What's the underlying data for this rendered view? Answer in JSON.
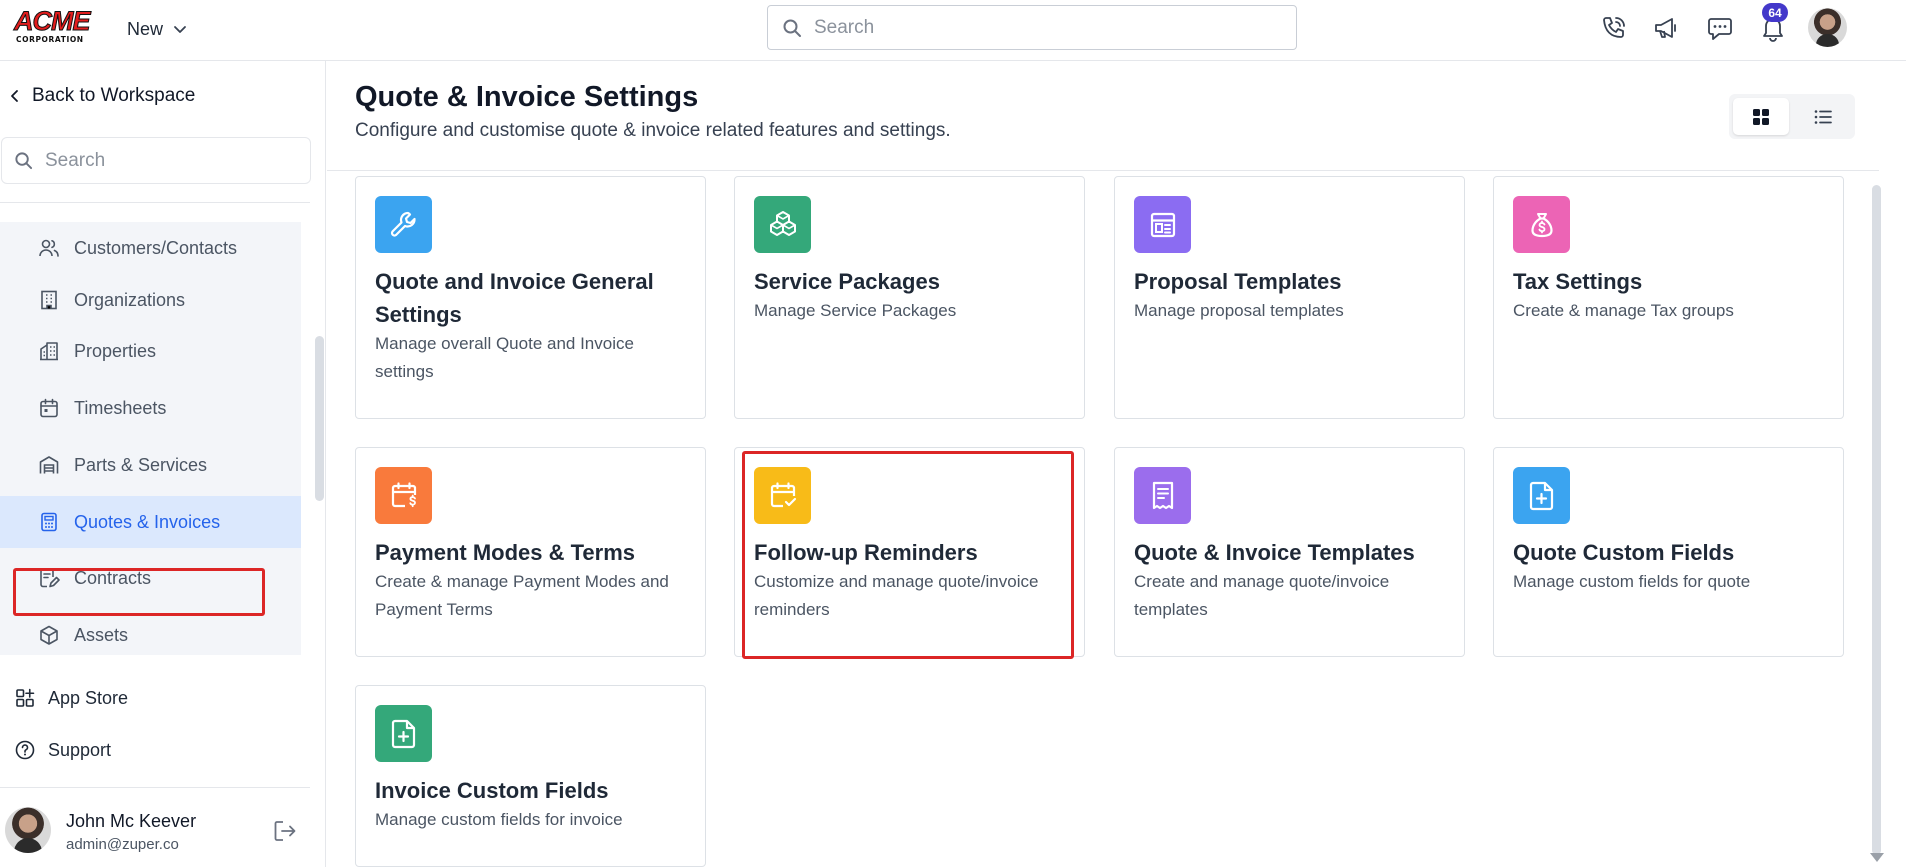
{
  "logo": {
    "main": "ACME",
    "sub": "CORPORATION"
  },
  "header": {
    "new_label": "New",
    "search_placeholder": "Search",
    "notification_count": "64"
  },
  "sidebar": {
    "back_label": "Back to Workspace",
    "search_placeholder": "Search",
    "items": [
      {
        "label": "Customers/Contacts",
        "icon": "users-icon"
      },
      {
        "label": "Organizations",
        "icon": "building-icon"
      },
      {
        "label": "Properties",
        "icon": "property-icon"
      },
      {
        "label": "Timesheets",
        "icon": "calendar-icon"
      },
      {
        "label": "Parts & Services",
        "icon": "warehouse-icon"
      },
      {
        "label": "Quotes & Invoices",
        "icon": "calculator-icon",
        "active": true
      },
      {
        "label": "Contracts",
        "icon": "contract-icon"
      },
      {
        "label": "Assets",
        "icon": "cube-icon"
      }
    ],
    "app_store_label": "App Store",
    "support_label": "Support",
    "user": {
      "name": "John Mc Keever",
      "email": "admin@zuper.co"
    }
  },
  "main": {
    "title": "Quote & Invoice Settings",
    "subtitle": "Configure and customise quote & invoice related features and settings.",
    "cards": [
      {
        "title": "Quote and Invoice General Settings",
        "description": "Manage overall Quote and Invoice settings",
        "color": "#3ba4f0",
        "icon": "wrench-icon"
      },
      {
        "title": "Service Packages",
        "description": "Manage Service Packages",
        "color": "#34a87a",
        "icon": "boxes-icon"
      },
      {
        "title": "Proposal Templates",
        "description": "Manage proposal templates",
        "color": "#8b6cf2",
        "icon": "template-icon"
      },
      {
        "title": "Tax Settings",
        "description": "Create & manage Tax groups",
        "color": "#ec64b5",
        "icon": "money-bag-icon"
      },
      {
        "title": "Payment Modes & Terms",
        "description": "Create & manage Payment Modes and Payment Terms",
        "color": "#f97a3c",
        "icon": "calendar-dollar-icon"
      },
      {
        "title": "Follow-up Reminders",
        "description": "Customize and manage quote/invoice reminders",
        "color": "#f8bb18",
        "icon": "calendar-check-icon"
      },
      {
        "title": "Quote & Invoice Templates",
        "description": "Create and manage quote/invoice templates",
        "color": "#9b6ded",
        "icon": "receipt-icon"
      },
      {
        "title": "Quote Custom Fields",
        "description": "Manage custom fields for quote",
        "color": "#3ba4f0",
        "icon": "file-plus-icon"
      },
      {
        "title": "Invoice Custom Fields",
        "description": "Manage custom fields for invoice",
        "color": "#34a87a",
        "icon": "file-plus-icon"
      }
    ]
  }
}
